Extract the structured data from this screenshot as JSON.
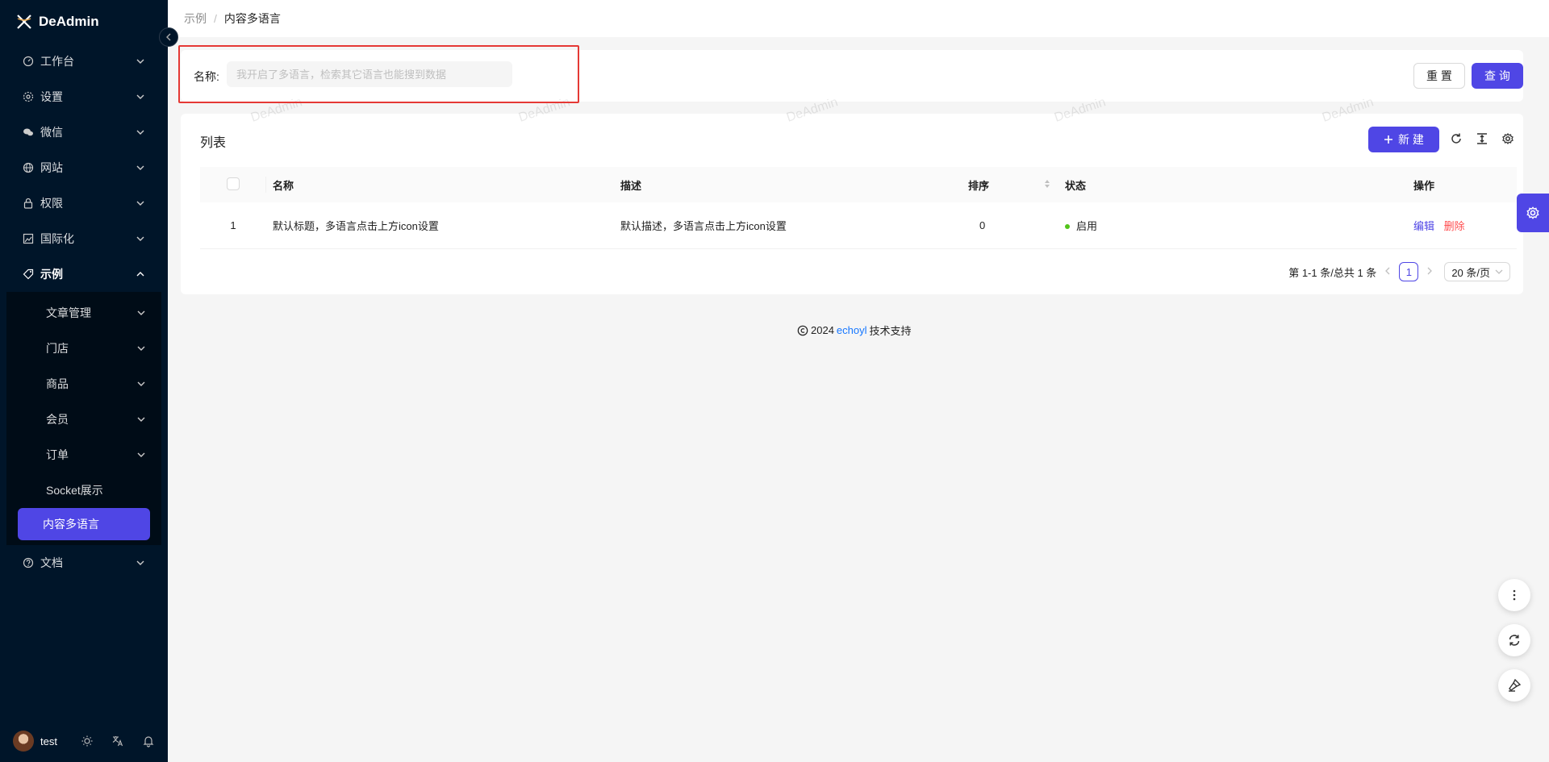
{
  "app": {
    "name": "DeAdmin"
  },
  "sidebar": {
    "items": [
      {
        "label": "工作台",
        "icon": "dashboard-icon"
      },
      {
        "label": "设置",
        "icon": "gear-icon"
      },
      {
        "label": "微信",
        "icon": "wechat-icon"
      },
      {
        "label": "网站",
        "icon": "globe-icon"
      },
      {
        "label": "权限",
        "icon": "lock-icon"
      },
      {
        "label": "国际化",
        "icon": "image-translate-icon"
      },
      {
        "label": "示例",
        "icon": "tag-icon"
      },
      {
        "label": "文档",
        "icon": "question-circle-icon"
      }
    ],
    "submenu": [
      {
        "label": "文章管理"
      },
      {
        "label": "门店"
      },
      {
        "label": "商品"
      },
      {
        "label": "会员"
      },
      {
        "label": "订单"
      },
      {
        "label": "Socket展示"
      },
      {
        "label": "内容多语言"
      }
    ],
    "user": {
      "name": "test"
    }
  },
  "breadcrumb": {
    "parent": "示例",
    "separator": "/",
    "current": "内容多语言"
  },
  "search": {
    "label": "名称:",
    "placeholder": "我开启了多语言，检索其它语言也能搜到数据",
    "value": "",
    "reset_label": "重 置",
    "query_label": "查 询"
  },
  "watermark": "DeAdmin",
  "list": {
    "title": "列表",
    "new_label": "新 建",
    "columns": [
      "名称",
      "描述",
      "排序",
      "状态",
      "操作"
    ],
    "rows": [
      {
        "index": "1",
        "name": "默认标题，多语言点击上方icon设置",
        "desc": "默认描述，多语言点击上方icon设置",
        "sort": "0",
        "status": "启用",
        "edit": "编辑",
        "delete": "删除"
      }
    ],
    "pagination": {
      "summary": "第 1-1 条/总共 1 条",
      "current": "1",
      "page_size": "20 条/页"
    }
  },
  "footer": {
    "year": "2024",
    "link": "echoyl",
    "suffix": "技术支持"
  },
  "colors": {
    "primary": "#4f46e5",
    "sidebar": "#001529",
    "danger": "#ff4d4f",
    "success": "#52c41a",
    "highlight": "#e53935"
  }
}
